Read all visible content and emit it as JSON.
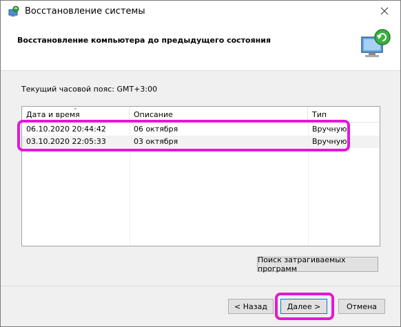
{
  "window": {
    "title": "Восстановление системы"
  },
  "header": {
    "title": "Восстановление компьютера до предыдущего состояния"
  },
  "timezone_label": "Текущий часовой пояс: GMT+3:00",
  "list": {
    "columns": [
      "Дата и время",
      "Описание",
      "Тип"
    ],
    "sorted_column_indicator": "chevron-down-icon",
    "rows": [
      {
        "datetime": "06.10.2020 20:44:42",
        "description": "06 октября",
        "type": "Вручную"
      },
      {
        "datetime": "03.10.2020 22:05:33",
        "description": "03 октября",
        "type": "Вручную"
      }
    ]
  },
  "buttons": {
    "scan": "Поиск затрагиваемых программ",
    "back": "< Назад",
    "next": "Далее >",
    "cancel": "Отмена"
  },
  "colors": {
    "highlight": "#e516d9",
    "header_bg": "#ffffff",
    "dialog_bg": "#f0f0f0",
    "default_button_border": "#0078d7"
  },
  "icons": {
    "title": "system-restore-icon",
    "header": "computer-restore-icon",
    "close": "close-icon"
  }
}
